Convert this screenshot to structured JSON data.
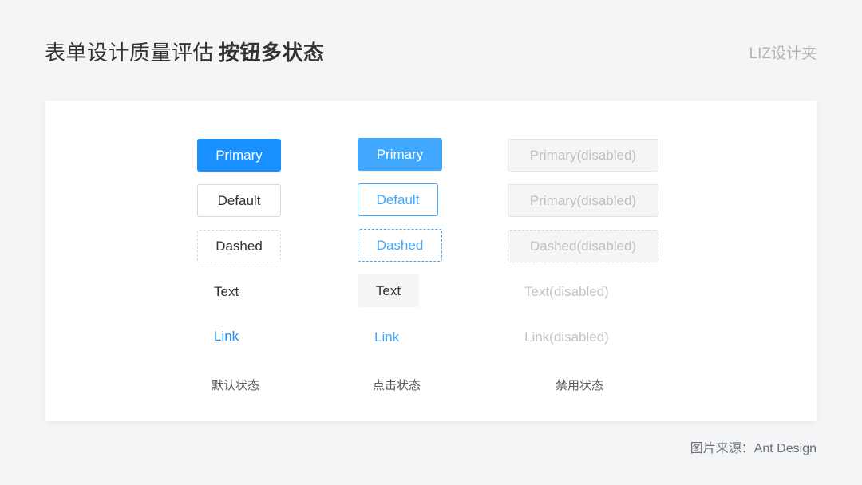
{
  "header": {
    "title_regular": "表单设计质量评估",
    "title_bold": "按钮多状态",
    "brand": "LIZ设计夹"
  },
  "colors": {
    "primary": "#1890ff",
    "primary_active": "#40a9ff",
    "disabled_text": "#bfbfbf",
    "disabled_bg": "#f5f5f5",
    "page_bg": "#f4f5f7"
  },
  "columns": [
    {
      "state": "default",
      "label": "默认状态",
      "buttons": {
        "primary": "Primary",
        "default": "Default",
        "dashed": "Dashed",
        "text": "Text",
        "link": "Link"
      }
    },
    {
      "state": "active",
      "label": "点击状态",
      "buttons": {
        "primary": "Primary",
        "default": "Default",
        "dashed": "Dashed",
        "text": "Text",
        "link": "Link"
      }
    },
    {
      "state": "disabled",
      "label": "禁用状态",
      "buttons": {
        "primary": "Primary(disabled)",
        "default": "Primary(disabled)",
        "dashed": "Dashed(disabled)",
        "text": "Text(disabled)",
        "link": "Link(disabled)"
      }
    }
  ],
  "footer": {
    "source": "图片来源：Ant Design"
  }
}
